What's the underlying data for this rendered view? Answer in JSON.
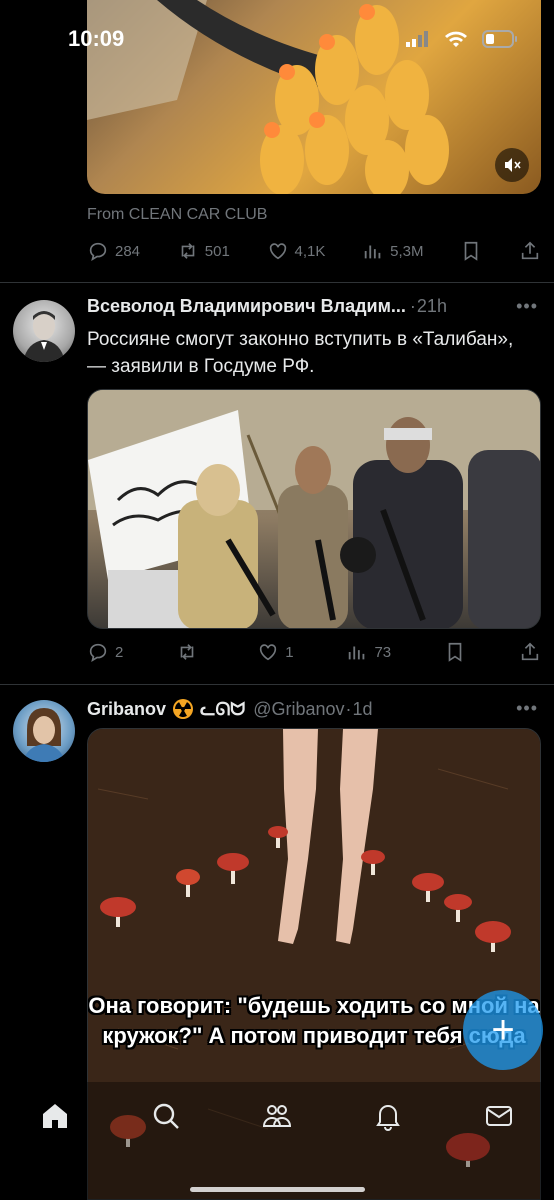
{
  "status": {
    "time": "10:09"
  },
  "tweets": [
    {
      "source_label": "From CLEAN CAR CLUB",
      "replies": "284",
      "retweets": "501",
      "likes": "4,1K",
      "views": "5,3M"
    },
    {
      "author": "Всеволод Владимирович Владим...",
      "time": "21h",
      "text": "Россияне смогут законно вступить в «Талибан», — заявили в Госдуме РФ.",
      "replies": "2",
      "retweets": "",
      "likes": "1",
      "views": "73"
    },
    {
      "author": "Gribanov",
      "author_suffix": "ᓚᘏᗢ",
      "handle": "@Gribanov",
      "time": "1d",
      "image_caption": "Она говорит: \"будешь ходить со мной на кружок?\" А потом приводит тебя сюда"
    }
  ],
  "colors": {
    "accent": "#1d9bf0",
    "muted": "#71767b",
    "divider": "#2f3336",
    "badge": "#f5a623"
  },
  "tabs": [
    "home-icon",
    "search-icon",
    "communities-icon",
    "notifications-icon",
    "messages-icon"
  ]
}
